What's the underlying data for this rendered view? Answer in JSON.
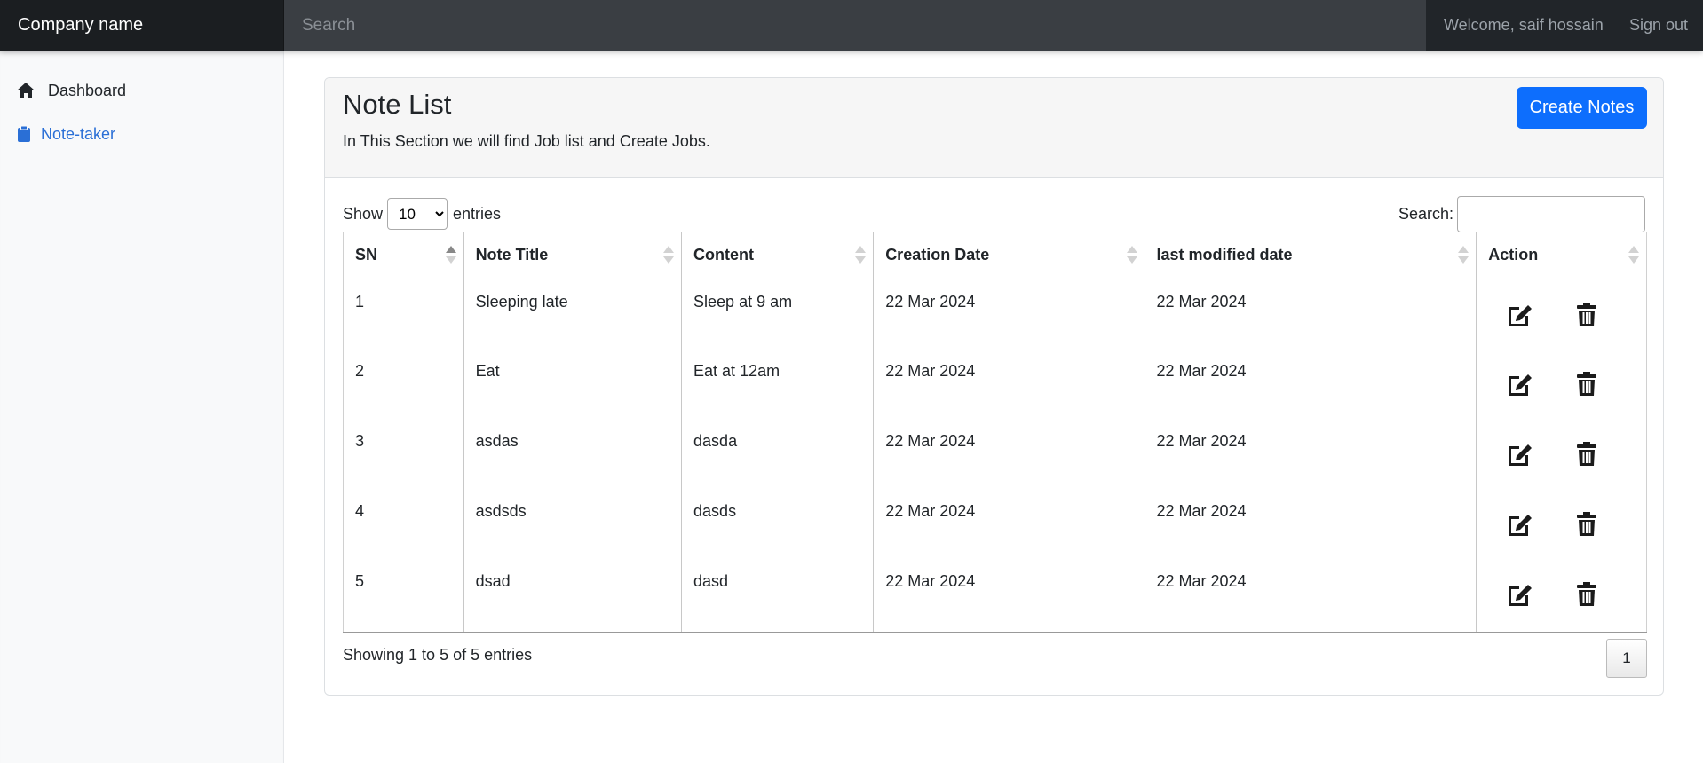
{
  "topbar": {
    "brand": "Company name",
    "search_placeholder": "Search",
    "welcome": "Welcome, saif hossain",
    "signout": "Sign out"
  },
  "sidebar": {
    "items": [
      {
        "label": "Dashboard",
        "icon": "home-icon"
      },
      {
        "label": "Note-taker",
        "icon": "clipboard-icon",
        "active": true
      }
    ]
  },
  "main": {
    "title": "Note List",
    "subtitle": "In This Section we will find Job list and Create Jobs.",
    "create_label": "Create Notes",
    "show_label": "Show",
    "entries_label": "entries",
    "page_length": "10",
    "search_label": "Search:",
    "search_value": "",
    "columns": [
      "SN",
      "Note Title",
      "Content",
      "Creation Date",
      "last modified date",
      "Action"
    ],
    "rows": [
      {
        "sn": "1",
        "title": "Sleeping late",
        "content": "Sleep at 9 am",
        "created": "22 Mar 2024",
        "modified": "22 Mar 2024"
      },
      {
        "sn": "2",
        "title": "Eat",
        "content": "Eat at 12am",
        "created": "22 Mar 2024",
        "modified": "22 Mar 2024"
      },
      {
        "sn": "3",
        "title": "asdas",
        "content": "dasda",
        "created": "22 Mar 2024",
        "modified": "22 Mar 2024"
      },
      {
        "sn": "4",
        "title": "asdsds",
        "content": "dasds",
        "created": "22 Mar 2024",
        "modified": "22 Mar 2024"
      },
      {
        "sn": "5",
        "title": "dsad",
        "content": "dasd",
        "created": "22 Mar 2024",
        "modified": "22 Mar 2024"
      }
    ],
    "info": "Showing 1 to 5 of 5 entries",
    "current_page": "1"
  },
  "colors": {
    "topbar": "#212529",
    "accent": "#0d6efd",
    "active_link": "#2a6fd6"
  }
}
